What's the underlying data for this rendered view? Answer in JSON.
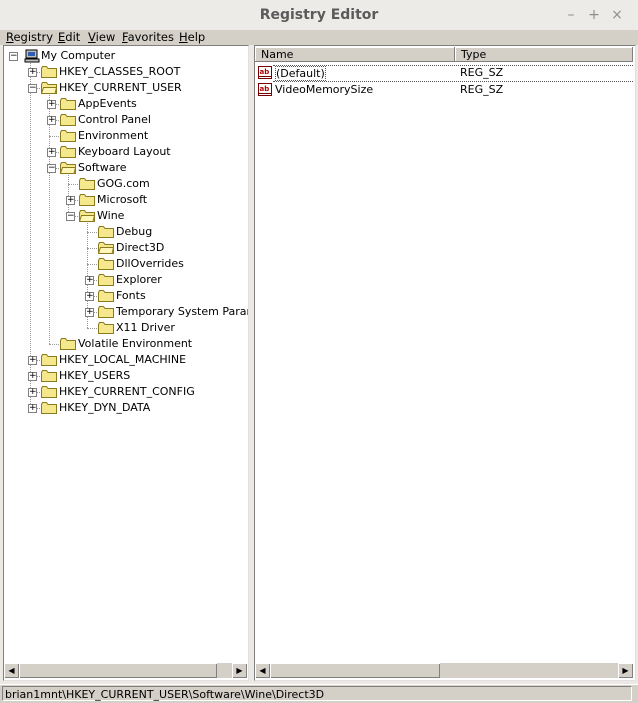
{
  "window": {
    "title": "Registry Editor",
    "controls": [
      "–",
      "+",
      "×"
    ]
  },
  "menu": [
    {
      "pre": "",
      "u": "R",
      "post": "egistry"
    },
    {
      "pre": "",
      "u": "E",
      "post": "dit"
    },
    {
      "pre": "",
      "u": "V",
      "post": "iew"
    },
    {
      "pre": "",
      "u": "F",
      "post": "avorites"
    },
    {
      "pre": "",
      "u": "H",
      "post": "elp"
    }
  ],
  "tree": {
    "root": "My Computer",
    "nodes": [
      {
        "label": "HKEY_CLASSES_ROOT",
        "level": 1,
        "expander": "+"
      },
      {
        "label": "HKEY_CURRENT_USER",
        "level": 1,
        "expander": "-"
      },
      {
        "label": "AppEvents",
        "level": 2,
        "expander": "+"
      },
      {
        "label": "Control Panel",
        "level": 2,
        "expander": "+"
      },
      {
        "label": "Environment",
        "level": 2,
        "expander": ""
      },
      {
        "label": "Keyboard Layout",
        "level": 2,
        "expander": "+"
      },
      {
        "label": "Software",
        "level": 2,
        "expander": "-"
      },
      {
        "label": "GOG.com",
        "level": 3,
        "expander": ""
      },
      {
        "label": "Microsoft",
        "level": 3,
        "expander": "+"
      },
      {
        "label": "Wine",
        "level": 3,
        "expander": "-"
      },
      {
        "label": "Debug",
        "level": 4,
        "expander": ""
      },
      {
        "label": "Direct3D",
        "level": 4,
        "expander": "",
        "selected": true
      },
      {
        "label": "DllOverrides",
        "level": 4,
        "expander": ""
      },
      {
        "label": "Explorer",
        "level": 4,
        "expander": "+"
      },
      {
        "label": "Fonts",
        "level": 4,
        "expander": "+"
      },
      {
        "label": "Temporary System Paramet",
        "level": 4,
        "expander": "+"
      },
      {
        "label": "X11 Driver",
        "level": 4,
        "expander": ""
      },
      {
        "label": "Volatile Environment",
        "level": 2,
        "expander": ""
      },
      {
        "label": "HKEY_LOCAL_MACHINE",
        "level": 1,
        "expander": "+"
      },
      {
        "label": "HKEY_USERS",
        "level": 1,
        "expander": "+"
      },
      {
        "label": "HKEY_CURRENT_CONFIG",
        "level": 1,
        "expander": "+"
      },
      {
        "label": "HKEY_DYN_DATA",
        "level": 1,
        "expander": "+"
      }
    ]
  },
  "list": {
    "columns": [
      "Name",
      "Type"
    ],
    "rows": [
      {
        "name": "(Default)",
        "type": "REG_SZ",
        "icon": "string-value-icon"
      },
      {
        "name": "VideoMemorySize",
        "type": "REG_SZ",
        "icon": "string-value-icon"
      }
    ]
  },
  "scroll_arrows": {
    "left": "◀",
    "right": "▶"
  },
  "status": "brian1mnt\\HKEY_CURRENT_USER\\Software\\Wine\\Direct3D",
  "colors": {
    "folder": "#f5e78c",
    "folder_edge": "#8a7b20",
    "chrome": "#d4d0c8"
  }
}
